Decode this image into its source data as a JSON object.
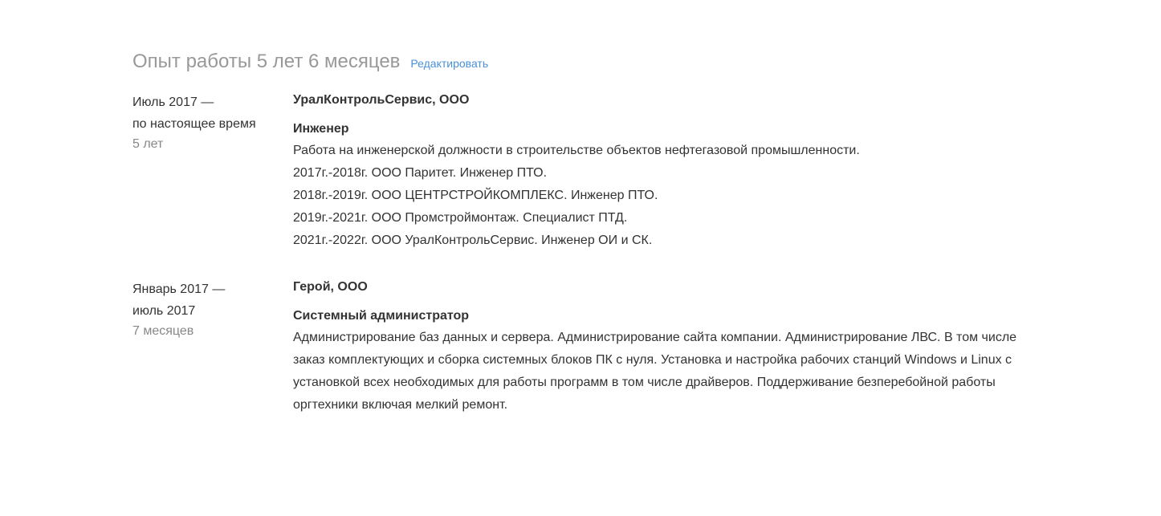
{
  "experience": {
    "title": "Опыт работы 5 лет 6 месяцев",
    "edit_label": "Редактировать",
    "entries": [
      {
        "period_start": "Июль 2017 —",
        "period_end": "по настоящее время",
        "duration": "5 лет",
        "company": "УралКонтрольСервис, ООО",
        "position": "Инженер",
        "description_lines": [
          "Работа на инженерской должности в строительстве объектов нефтегазовой промышленности.",
          "2017г.-2018г. ООО Паритет. Инженер ПТО.",
          "2018г.-2019г. ООО ЦЕНТРСТРОЙКОМПЛЕКС. Инженер ПТО.",
          "2019г.-2021г. ООО Промстроймонтаж. Специалист ПТД.",
          "2021г.-2022г. ООО УралКонтрольСервис. Инженер ОИ и СК."
        ]
      },
      {
        "period_start": "Январь 2017 —",
        "period_end": "июль 2017",
        "duration": "7 месяцев",
        "company": "Герой, ООО",
        "position": "Системный администратор",
        "description": "Администрирование баз данных и сервера. Администрирование сайта компании. Администрирование ЛВС. В том числе заказ комплектующих и сборка системных блоков ПК с нуля. Установка и настройка рабочих станций Windows и Linux с установкой всех необходимых для работы программ в том числе драйверов. Поддерживание безперебойной работы оргтехники включая мелкий ремонт."
      }
    ]
  }
}
